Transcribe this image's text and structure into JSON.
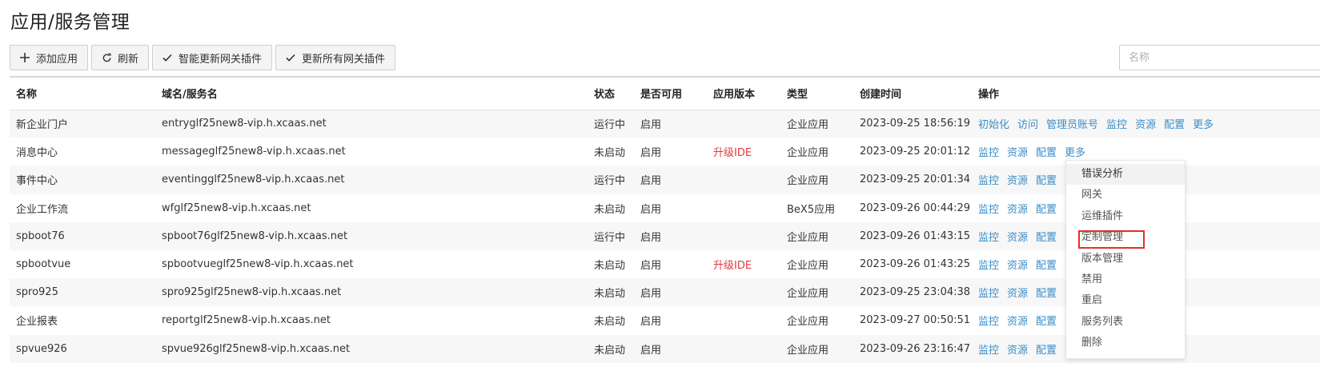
{
  "page": {
    "title": "应用/服务管理"
  },
  "toolbar": {
    "add_label": "添加应用",
    "refresh_label": "刷新",
    "smart_update_label": "智能更新网关插件",
    "update_all_label": "更新所有网关插件"
  },
  "search": {
    "placeholder": "名称"
  },
  "table": {
    "columns": [
      "名称",
      "域名/服务名",
      "状态",
      "是否可用",
      "应用版本",
      "类型",
      "创建时间",
      "操作"
    ],
    "rows": [
      {
        "name": "新企业门户",
        "domain": "entryglf25new8-vip.h.xcaas.net",
        "status": "运行中",
        "enabled": "启用",
        "version": "",
        "type": "企业应用",
        "created": "2023-09-25 18:56:19",
        "ops": [
          "初始化",
          "访问",
          "管理员账号",
          "监控",
          "资源",
          "配置",
          "更多"
        ]
      },
      {
        "name": "消息中心",
        "domain": "messageglf25new8-vip.h.xcaas.net",
        "status": "未启动",
        "enabled": "启用",
        "version": "升级IDE",
        "type": "企业应用",
        "created": "2023-09-25 20:01:12",
        "ops": [
          "监控",
          "资源",
          "配置",
          "更多"
        ]
      },
      {
        "name": "事件中心",
        "domain": "eventingglf25new8-vip.h.xcaas.net",
        "status": "运行中",
        "enabled": "启用",
        "version": "",
        "type": "企业应用",
        "created": "2023-09-25 20:01:34",
        "ops": [
          "监控",
          "资源",
          "配置"
        ]
      },
      {
        "name": "企业工作流",
        "domain": "wfglf25new8-vip.h.xcaas.net",
        "status": "未启动",
        "enabled": "启用",
        "version": "",
        "type": "BeX5应用",
        "created": "2023-09-26 00:44:29",
        "ops": [
          "监控",
          "资源",
          "配置"
        ]
      },
      {
        "name": "spboot76",
        "domain": "spboot76glf25new8-vip.h.xcaas.net",
        "status": "运行中",
        "enabled": "启用",
        "version": "",
        "type": "企业应用",
        "created": "2023-09-26 01:43:15",
        "ops": [
          "监控",
          "资源",
          "配置"
        ]
      },
      {
        "name": "spbootvue",
        "domain": "spbootvueglf25new8-vip.h.xcaas.net",
        "status": "未启动",
        "enabled": "启用",
        "version": "升级IDE",
        "type": "企业应用",
        "created": "2023-09-26 01:43:25",
        "ops": [
          "监控",
          "资源",
          "配置"
        ]
      },
      {
        "name": "spro925",
        "domain": "spro925glf25new8-vip.h.xcaas.net",
        "status": "未启动",
        "enabled": "启用",
        "version": "",
        "type": "企业应用",
        "created": "2023-09-25 23:04:38",
        "ops": [
          "监控",
          "资源",
          "配置"
        ]
      },
      {
        "name": "企业报表",
        "domain": "reportglf25new8-vip.h.xcaas.net",
        "status": "未启动",
        "enabled": "启用",
        "version": "",
        "type": "企业应用",
        "created": "2023-09-27 00:50:51",
        "ops": [
          "监控",
          "资源",
          "配置"
        ]
      },
      {
        "name": "spvue926",
        "domain": "spvue926glf25new8-vip.h.xcaas.net",
        "status": "未启动",
        "enabled": "启用",
        "version": "",
        "type": "企业应用",
        "created": "2023-09-26 23:16:47",
        "ops": [
          "监控",
          "资源",
          "配置"
        ]
      }
    ]
  },
  "more_menu": {
    "items": [
      "错误分析",
      "网关",
      "运维插件",
      "定制管理",
      "版本管理",
      "禁用",
      "重启",
      "服务列表",
      "删除"
    ],
    "highlighted": "定制管理"
  },
  "colors": {
    "link": "#3a8ec9",
    "warning": "#e4393c",
    "highlight_box": "#e52e2e"
  },
  "icons": {
    "add": "plus-icon",
    "refresh": "refresh-icon",
    "check": "check-icon"
  }
}
